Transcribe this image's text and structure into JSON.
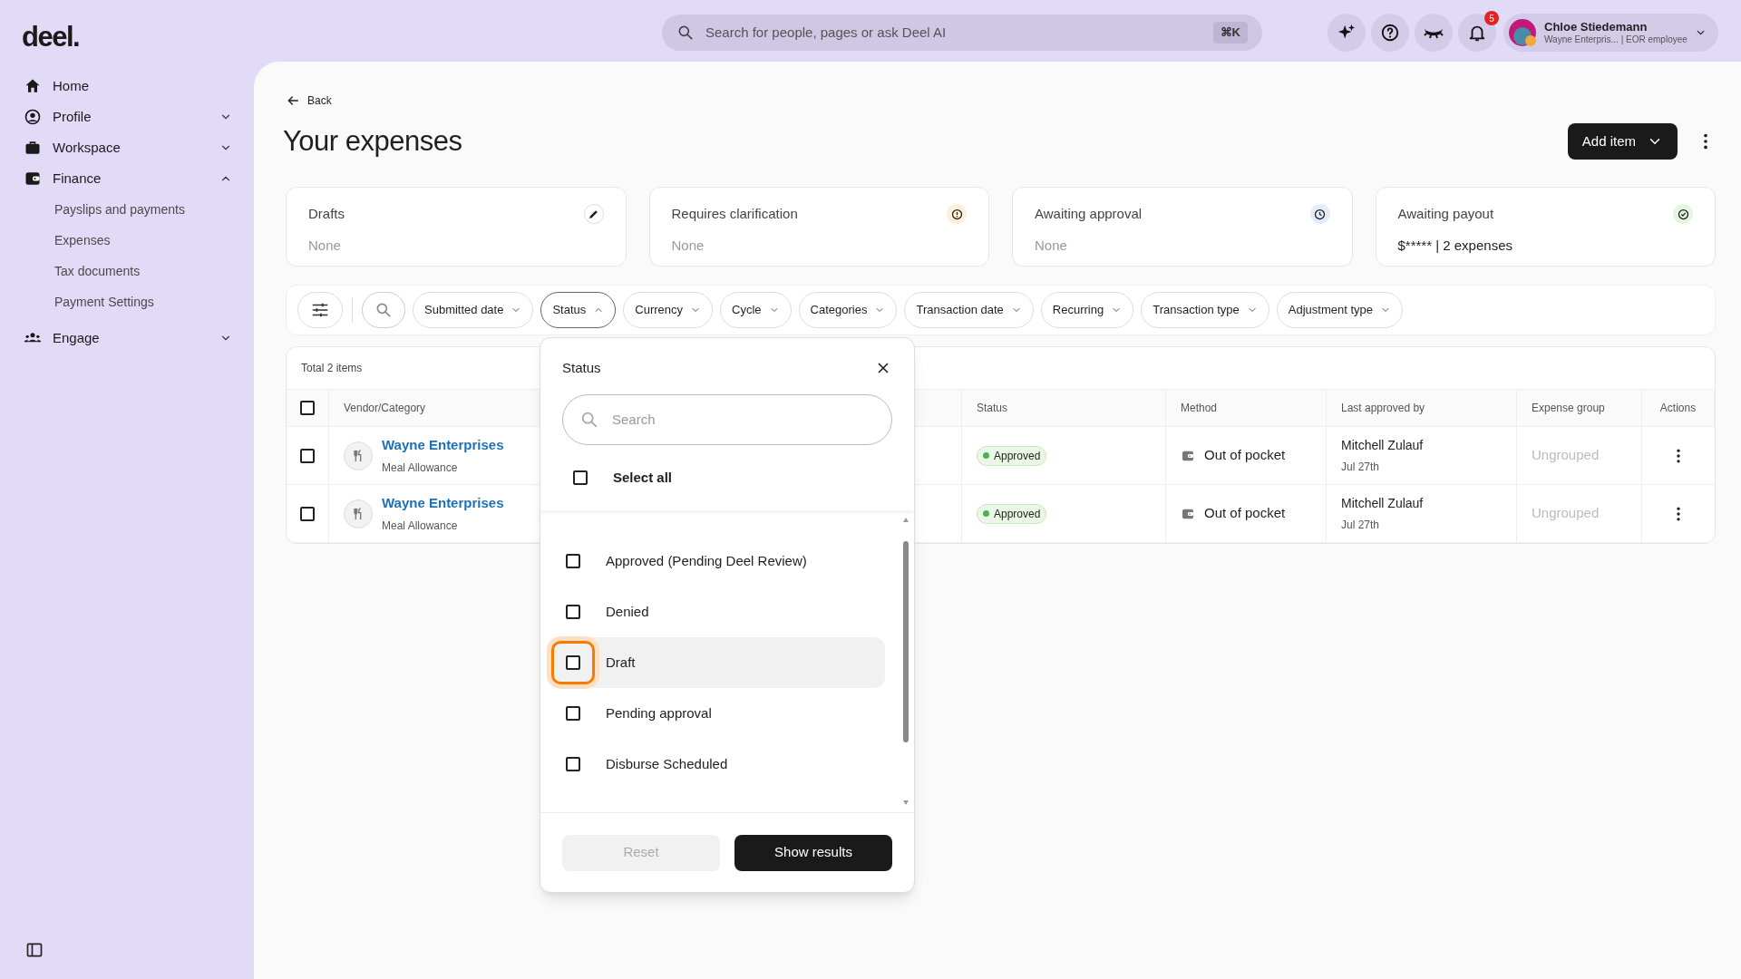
{
  "logo": "deel.",
  "search": {
    "placeholder": "Search for people, pages or ask Deel AI",
    "shortcut": "⌘K"
  },
  "header_icons": [
    {
      "kind": "sparkle"
    },
    {
      "kind": "help"
    },
    {
      "kind": "eye"
    },
    {
      "kind": "bell",
      "badge": "5"
    }
  ],
  "user": {
    "name": "Chloe Stiedemann",
    "subtitle": "Wayne Enterpris... | EOR employee"
  },
  "sidebar": {
    "items": [
      {
        "label": "Home",
        "kind": "home",
        "has_children": false
      },
      {
        "label": "Profile",
        "kind": "profile",
        "expanded": false,
        "has_children": true
      },
      {
        "label": "Workspace",
        "kind": "briefcase",
        "expanded": false,
        "has_children": true
      },
      {
        "label": "Finance",
        "kind": "wallet",
        "expanded": true,
        "has_children": true,
        "children": [
          {
            "label": "Payslips and payments"
          },
          {
            "label": "Expenses"
          },
          {
            "label": "Tax documents"
          },
          {
            "label": "Payment Settings"
          }
        ]
      },
      {
        "label": "Engage",
        "kind": "people",
        "expanded": false,
        "has_children": true
      }
    ]
  },
  "back": "Back",
  "title": "Your expenses",
  "add_button": "Add item",
  "cards": [
    {
      "title": "Drafts",
      "value": "None",
      "kind": "pencil",
      "empty": true
    },
    {
      "title": "Requires clarification",
      "value": "None",
      "kind": "alert",
      "empty": true
    },
    {
      "title": "Awaiting approval",
      "value": "None",
      "kind": "clock",
      "empty": true
    },
    {
      "title": "Awaiting payout",
      "value": "$***** | 2 expenses",
      "kind": "check",
      "empty": false
    }
  ],
  "filters": [
    {
      "label": "Submitted date",
      "open": false
    },
    {
      "label": "Status",
      "open": true
    },
    {
      "label": "Currency",
      "open": false
    },
    {
      "label": "Cycle",
      "open": false
    },
    {
      "label": "Categories",
      "open": false
    },
    {
      "label": "Transaction date",
      "open": false
    },
    {
      "label": "Recurring",
      "open": false
    },
    {
      "label": "Transaction type",
      "open": false
    },
    {
      "label": "Adjustment type",
      "open": false
    }
  ],
  "table": {
    "total": "Total 2 items",
    "all_checked": false,
    "columns": [
      "Vendor/Category",
      "Status",
      "Method",
      "Last approved by",
      "Expense group",
      "Actions"
    ],
    "rows": [
      {
        "checked": false,
        "vendor": "Wayne Enterprises",
        "category": "Meal Allowance",
        "status": "Approved",
        "method": "Out of pocket",
        "approver": "Mitchell Zulauf",
        "date": "Jul 27th",
        "group": "Ungrouped"
      },
      {
        "checked": false,
        "vendor": "Wayne Enterprises",
        "category": "Meal Allowance",
        "status": "Approved",
        "method": "Out of pocket",
        "approver": "Mitchell Zulauf",
        "date": "Jul 27th",
        "group": "Ungrouped"
      }
    ]
  },
  "status_dropdown": {
    "title": "Status",
    "search_placeholder": "Search",
    "select_all": {
      "label": "Select all",
      "checked": false
    },
    "options": [
      {
        "label": "Approved (Pending Deel Review)",
        "checked": false,
        "highlighted": false
      },
      {
        "label": "Denied",
        "checked": false,
        "highlighted": false
      },
      {
        "label": "Draft",
        "checked": false,
        "highlighted": true
      },
      {
        "label": "Pending approval",
        "checked": false,
        "highlighted": false
      },
      {
        "label": "Disburse Scheduled",
        "checked": false,
        "highlighted": false
      }
    ],
    "reset": "Reset",
    "reset_disabled": true,
    "submit": "Show results"
  }
}
